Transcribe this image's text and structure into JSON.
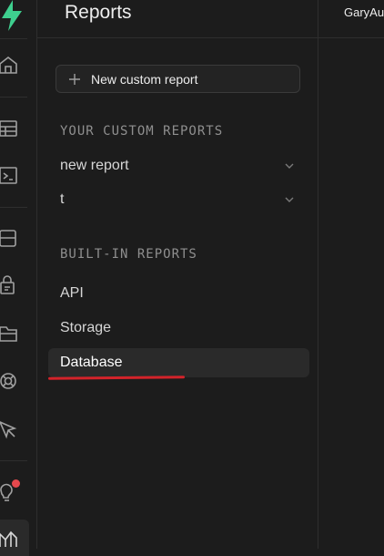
{
  "header": {
    "title": "Reports",
    "project": "GaryAu"
  },
  "actions": {
    "new_report_label": "New custom report"
  },
  "custom_reports": {
    "section_label": "YOUR CUSTOM REPORTS",
    "items": [
      {
        "label": "new report"
      },
      {
        "label": "t"
      }
    ]
  },
  "builtin_reports": {
    "section_label": "BUILT-IN REPORTS",
    "items": [
      {
        "label": "API"
      },
      {
        "label": "Storage"
      },
      {
        "label": "Database",
        "active": true
      }
    ]
  },
  "icons": [
    "logo-icon",
    "home-icon",
    "table-editor-icon",
    "sql-editor-icon",
    "database-icon",
    "auth-icon",
    "storage-icon",
    "realtime-icon",
    "edge-functions-icon",
    "advisors-icon",
    "reports-icon"
  ],
  "colors": {
    "brand": "#3ecf8e",
    "accent_underline": "#d3232a",
    "notification": "#e5484d"
  }
}
